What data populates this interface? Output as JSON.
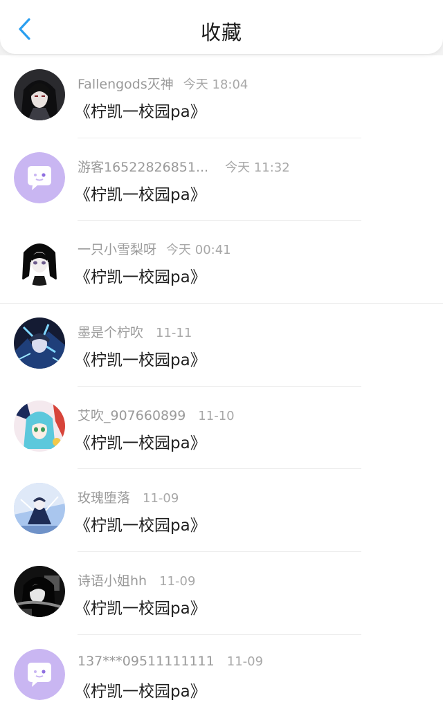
{
  "header": {
    "title": "收藏",
    "back_icon": "chevron-left-icon",
    "accent": "#2a9ff0"
  },
  "items": [
    {
      "user": "Fallengods灭神",
      "time": "今天 18:04",
      "text": "《柠凯一校园pa》",
      "avatar": "anime-avatar-dark-hair"
    },
    {
      "user": "游客16522826851...",
      "time": "今天 11:32",
      "text": "《柠凯一校园pa》",
      "avatar": "default-chat-avatar"
    },
    {
      "user": "一只小雪梨呀",
      "time": "今天 00:41",
      "text": "《柠凯一校园pa》",
      "avatar": "anime-avatar-girl"
    },
    {
      "user": "墨是个柠吹",
      "time": "11-11",
      "text": "《柠凯一校园pa》",
      "avatar": "anime-avatar-blue"
    },
    {
      "user": "艾吹_907660899",
      "time": "11-10",
      "text": "《柠凯一校园pa》",
      "avatar": "anime-avatar-colorful"
    },
    {
      "user": "玫瑰堕落",
      "time": "11-09",
      "text": "《柠凯一校园pa》",
      "avatar": "anime-avatar-sky"
    },
    {
      "user": "诗语小姐hh",
      "time": "11-09",
      "text": "《柠凯一校园pa》",
      "avatar": "anime-avatar-mono"
    },
    {
      "user": "137***09511111111",
      "time": "11-09",
      "text": "《柠凯一校园pa》",
      "avatar": "default-chat-avatar"
    }
  ]
}
